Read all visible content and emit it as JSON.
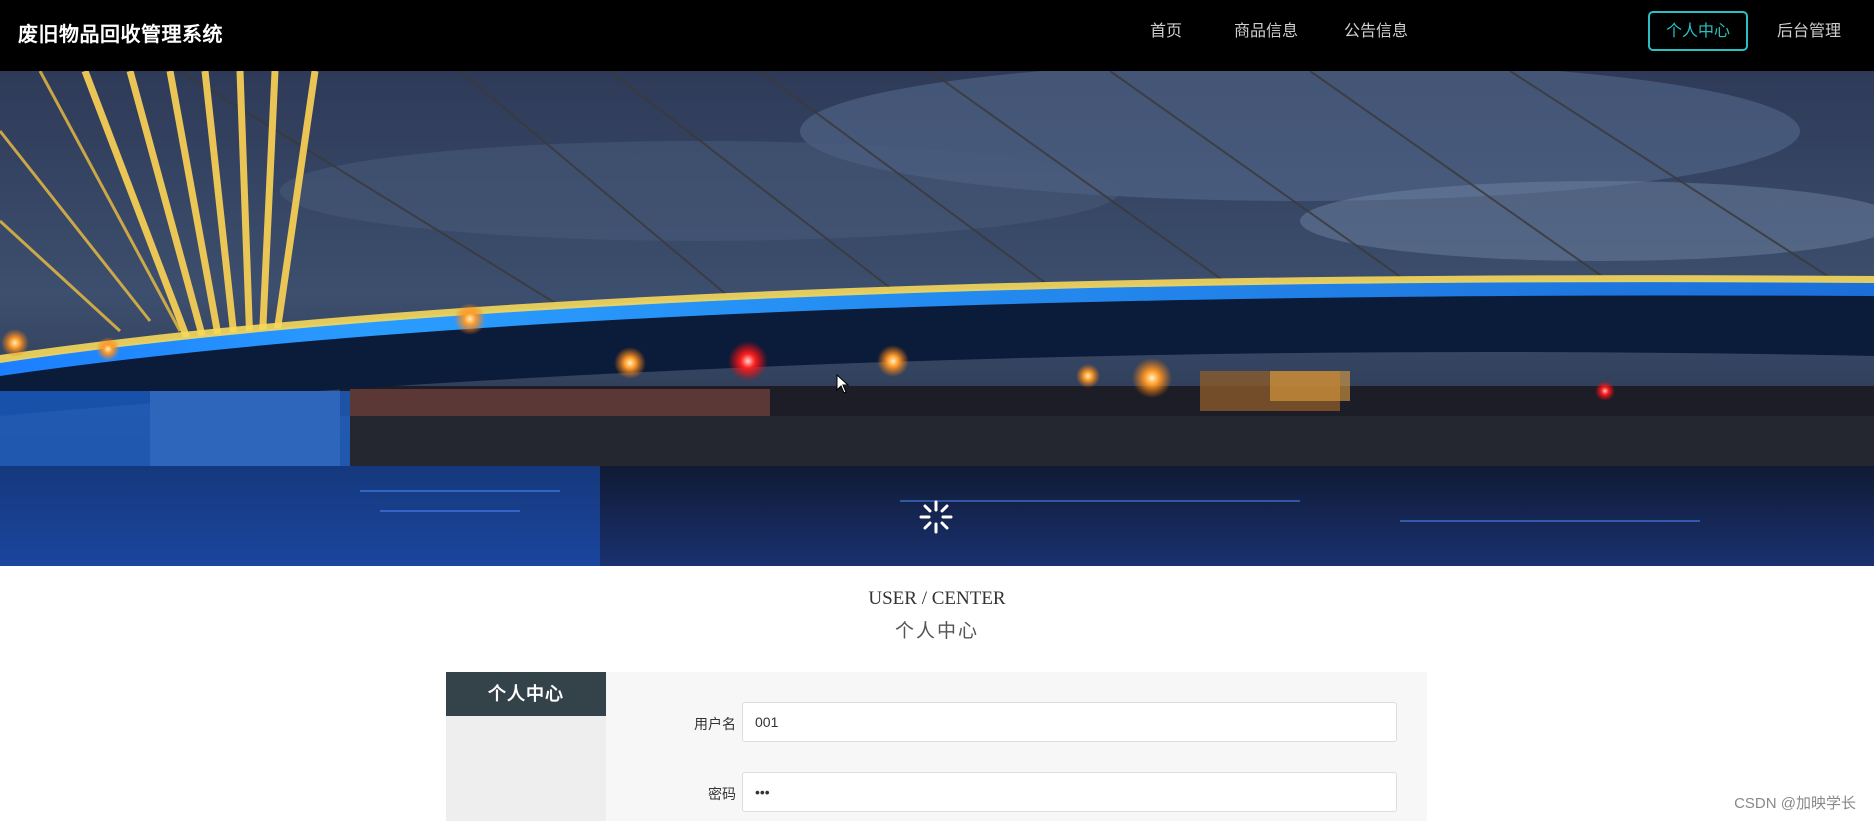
{
  "app": {
    "title": "废旧物品回收管理系统"
  },
  "nav": {
    "items": [
      {
        "label": "首页",
        "active": false
      },
      {
        "label": "商品信息",
        "active": false
      },
      {
        "label": "公告信息",
        "active": false
      },
      {
        "label": "个人中心",
        "active": true
      },
      {
        "label": "后台管理",
        "active": false
      }
    ]
  },
  "banner": {
    "slide_count": 3,
    "active_slide": 1
  },
  "section": {
    "title_en": "USER / CENTER",
    "title_cn": "个人中心"
  },
  "sidebar": {
    "title": "个人中心"
  },
  "form": {
    "username": {
      "label": "用户名",
      "value": "001"
    },
    "password": {
      "label": "密码",
      "value": "•••"
    }
  },
  "watermark": "CSDN @加映学长",
  "colors": {
    "accent": "#28c1c3",
    "topbar": "#000000",
    "sidebar_title": "#34424a"
  }
}
